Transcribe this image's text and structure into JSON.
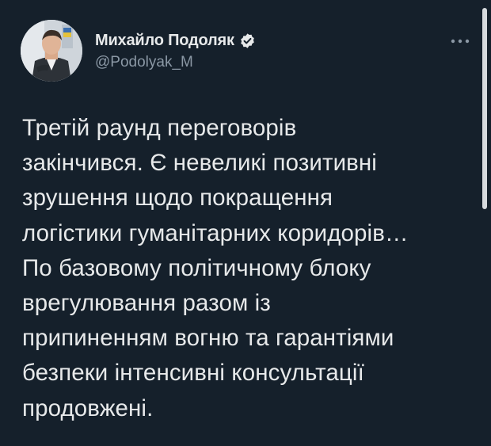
{
  "author": {
    "display_name": "Михайло Подоляк",
    "handle": "@Podolyak_M",
    "verified_icon": "verified-badge-icon"
  },
  "menu": {
    "icon": "more-horizontal-icon"
  },
  "tweet": {
    "text": "Третій раунд переговорів\nзакінчився. Є невеликі позитивні\nзрушення щодо покращення\nлогістики гуманітарних коридорів…\nПо базовому політичному блоку\nврегулювання разом із\nприпиненням вогню та гарантіями\nбезпеки інтенсивні консультації\nпродовжені."
  },
  "colors": {
    "background": "#15202b",
    "text": "#e7e9ea",
    "secondary_text": "#8b98a5"
  }
}
